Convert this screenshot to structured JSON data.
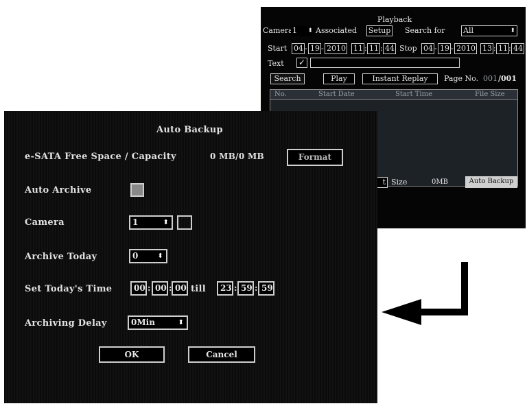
{
  "playback": {
    "title": "Playback",
    "camera_label": "Camera",
    "camera_value": "1",
    "associated_label": "Associated",
    "setup_button": "Setup",
    "search_for_label": "Search for",
    "search_for_value": "All",
    "start_label": "Start",
    "start_month": "04",
    "start_day": "19",
    "start_year": "2010",
    "start_hour": "11",
    "start_min": "11",
    "start_sec": "44",
    "stop_label": "Stop",
    "stop_month": "04",
    "stop_day": "19",
    "stop_year": "2010",
    "stop_hour": "13",
    "stop_min": "11",
    "stop_sec": "44",
    "text_label": "Text",
    "text_value": "",
    "search_button": "Search",
    "play_button": "Play",
    "instant_replay_button": "Instant Replay",
    "page_label": "Page No.",
    "page_current": "001",
    "page_total": "/001",
    "columns": [
      "No.",
      "Start Date",
      "Start Time",
      "File Size"
    ],
    "list_partial_label": "t",
    "size_label": "Size",
    "size_value": "0MB",
    "auto_backup_button": "Auto Backup"
  },
  "autobackup": {
    "title": "Auto Backup",
    "esata_label": "e-SATA Free Space / Capacity",
    "esata_value": "0 MB/0 MB",
    "format_button": "Format",
    "auto_archive_label": "Auto Archive",
    "camera_label": "Camera",
    "camera_value": "1",
    "archive_today_label": "Archive Today",
    "archive_today_value": "0",
    "set_time_label": "Set Today's Time",
    "from_h": "00",
    "from_m": "00",
    "from_s": "00",
    "till_label": "till",
    "to_h": "23",
    "to_m": "59",
    "to_s": "59",
    "archiving_delay_label": "Archiving Delay",
    "archiving_delay_value": "0Min",
    "ok_button": "OK",
    "cancel_button": "Cancel"
  },
  "spinner_glyph": "⬍",
  "sep_dash": "-",
  "sep_colon": ":"
}
